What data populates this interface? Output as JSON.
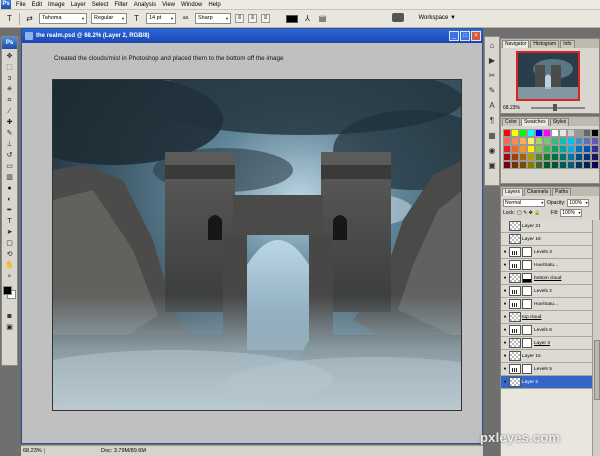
{
  "menubar": {
    "app_badge": "Ps",
    "items": [
      "File",
      "Edit",
      "Image",
      "Layer",
      "Select",
      "Filter",
      "Analysis",
      "View",
      "Window",
      "Help"
    ]
  },
  "options": {
    "tool_icon": "T",
    "font_family": "Tahoma",
    "font_style": "Regular",
    "font_size": "14 pt",
    "antialias_prefix": "aa",
    "antialias": "Sharp",
    "workspace": "Workspace ▼"
  },
  "document": {
    "title": "the realm.psd @ 68.2% (Layer 2, RGB/8)",
    "caption": "Created the clouds/mist in Photoshop and placed them to the bottom off the image",
    "status_zoom": "68.23%",
    "status_doc": "Doc: 3.79M/89.6M"
  },
  "navigator": {
    "tabs": [
      "Navigator",
      "Histogram",
      "Info"
    ],
    "zoom": "68.23%"
  },
  "swatches_panel": {
    "tabs": [
      "Color",
      "Swatches",
      "Styles"
    ],
    "colors": [
      "#ff0000",
      "#ffff00",
      "#00ff00",
      "#00ffff",
      "#0000ff",
      "#ff00ff",
      "#ffffff",
      "#e6e6e6",
      "#cccccc",
      "#999999",
      "#666666",
      "#000000",
      "#f26c4f",
      "#f68e55",
      "#fbaf5d",
      "#fff467",
      "#acd372",
      "#7cc576",
      "#3bb878",
      "#1abbb4",
      "#00bff3",
      "#438ccb",
      "#5574b9",
      "#605ca8",
      "#ed1c24",
      "#f26522",
      "#f7941d",
      "#fff200",
      "#8dc73f",
      "#39b54a",
      "#00a651",
      "#00a99d",
      "#00aeef",
      "#0072bc",
      "#0054a6",
      "#2e3192",
      "#9e0b0f",
      "#a0410d",
      "#a36209",
      "#aba000",
      "#598527",
      "#1a7b30",
      "#007236",
      "#00746b",
      "#0076a3",
      "#004b80",
      "#003471",
      "#1b1464",
      "#790000",
      "#7b2e00",
      "#7d4900",
      "#827b00",
      "#406618",
      "#005e20",
      "#005826",
      "#005952",
      "#005b7f",
      "#003663",
      "#002157",
      "#0d004c"
    ]
  },
  "layers_panel": {
    "tabs": [
      "Layers",
      "Channels",
      "Paths"
    ],
    "blend_mode": "Normal",
    "opacity_label": "Opacity:",
    "opacity": "100%",
    "lock_label": "Lock:",
    "fill_label": "Fill:",
    "fill": "100%",
    "layers": [
      {
        "name": "Layer 21",
        "visible": false,
        "kind": "pixel",
        "mask": "",
        "underline": false,
        "selected": false
      },
      {
        "name": "Layer 16",
        "visible": false,
        "kind": "pixel",
        "mask": "",
        "underline": false,
        "selected": false
      },
      {
        "name": "Levels 3",
        "visible": true,
        "kind": "adj",
        "mask": "white",
        "underline": false,
        "selected": false
      },
      {
        "name": "Hue/Satu...",
        "visible": true,
        "kind": "adj",
        "mask": "white",
        "underline": false,
        "selected": false
      },
      {
        "name": "bottom cloud",
        "visible": true,
        "kind": "pixel",
        "mask": "strip",
        "underline": true,
        "selected": false
      },
      {
        "name": "Levels 2",
        "visible": true,
        "kind": "adj",
        "mask": "white",
        "underline": false,
        "selected": false
      },
      {
        "name": "Hue/Satu...",
        "visible": true,
        "kind": "adj",
        "mask": "white",
        "underline": false,
        "selected": false
      },
      {
        "name": "top cloud",
        "visible": true,
        "kind": "pixel",
        "mask": "",
        "underline": true,
        "selected": false
      },
      {
        "name": "Levels 6",
        "visible": true,
        "kind": "adj",
        "mask": "white",
        "underline": false,
        "selected": false
      },
      {
        "name": "Layer 3",
        "visible": true,
        "kind": "pixel",
        "mask": "white",
        "underline": true,
        "selected": false
      },
      {
        "name": "Layer 15",
        "visible": true,
        "kind": "pixel",
        "mask": "",
        "underline": false,
        "selected": false
      },
      {
        "name": "Levels 5",
        "visible": true,
        "kind": "adj",
        "mask": "white",
        "underline": false,
        "selected": false
      },
      {
        "name": "Layer 2",
        "visible": true,
        "kind": "pixel",
        "mask": "",
        "underline": false,
        "selected": true
      }
    ]
  },
  "watermark": "pxleyes.com"
}
